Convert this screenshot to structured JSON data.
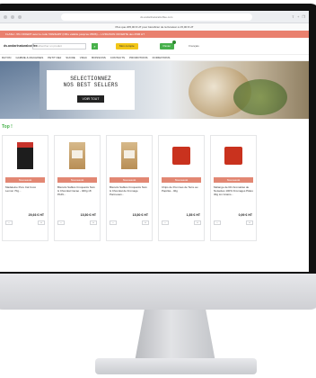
{
  "browser": {
    "url": "ds.andarlnaturalcoffee.com"
  },
  "top_notice": "Plus que 205,00 € HT pour bénéficier de la livraison à 15,00 € HT",
  "promo_banner": "FLASH: -5% OFFERT avec le code 'FRESH05' (Offre valable jusqu'au 05/06) -- LIVRAISON OFFERTE des 250€ HT",
  "header": {
    "logo": "ds.andarlnaturalcoffee",
    "search_placeholder": "Rechercher un produit",
    "account_label": "Mon compte",
    "cart_label": "Panier",
    "language": "Français"
  },
  "nav": {
    "items": [
      "RAYON",
      "GAMME & MACHINES",
      "PETIT DEJ",
      "SUCRE",
      "VRAC",
      "BOISSONS",
      "CONTACTS",
      "PROMOTIONS",
      "FORMATIONS"
    ]
  },
  "hero": {
    "title_line1": "SELECTIONNEZ",
    "title_line2": "NOS BEST SELLERS",
    "cta": "VOIR TOUT"
  },
  "section": {
    "title": "Top !"
  },
  "products": [
    {
      "badge": "Nouveauté",
      "name": "Madeleine Pure Cal Coco Lemon 70g...",
      "price": "29,93 € HT",
      "pkg": "black"
    },
    {
      "badge": "Nouveauté",
      "name": "Biscuits Sablés Croquants Noix & Chocolat Cacao - 400g x8 PAIN...",
      "price": "15,50 € HT",
      "pkg": "kraft"
    },
    {
      "badge": "Nouveauté",
      "name": "Biscuits Sablés Croquants Noix & Chocolat de Fromage Parmesan...",
      "price": "15,50 € HT",
      "pkg": "kraft"
    },
    {
      "badge": "Nouveauté",
      "name": "Chips de Pommes de Terre au Paprika - 40g",
      "price": "1,55 € HT",
      "pkg": "red"
    },
    {
      "badge": "Nouveauté",
      "name": "Mélange de Riz Aromatisé de Noisettes 100% Fromages Pâtes 30g Lin Grains...",
      "price": "0,99 € HT",
      "pkg": "red"
    }
  ]
}
